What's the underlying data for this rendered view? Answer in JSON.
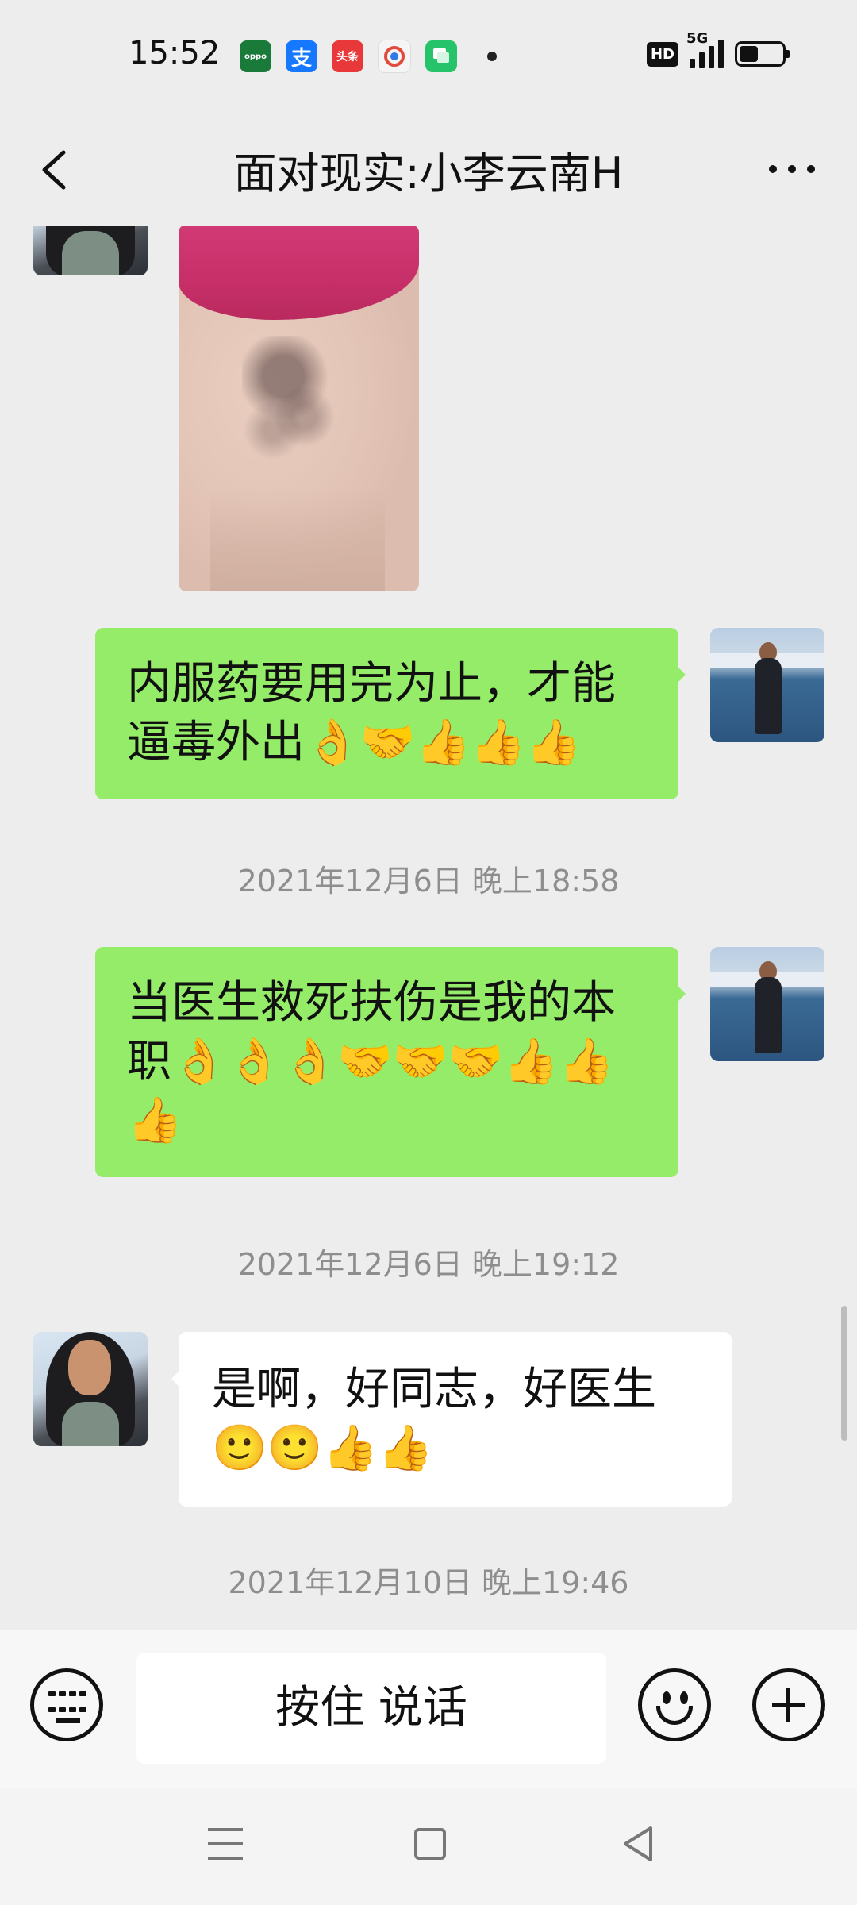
{
  "status_bar": {
    "time": "15:52",
    "apps": [
      {
        "name": "oppo-app-icon",
        "label": "oppo",
        "color": "#1a7a3a"
      },
      {
        "name": "alipay-icon",
        "label": "支",
        "color": "#1677ff"
      },
      {
        "name": "toutiao-icon",
        "label": "头条",
        "color": "#e8383a"
      },
      {
        "name": "browser-icon",
        "label": "",
        "color": "#f5f5f5"
      },
      {
        "name": "messages-icon",
        "label": "",
        "color": "#27c36a"
      }
    ],
    "hd_label": "HD",
    "network_label": "5G",
    "battery_level": 0.45
  },
  "header": {
    "title": "面对现实:小李云南H"
  },
  "messages": [
    {
      "type": "image",
      "side": "in"
    },
    {
      "type": "text",
      "side": "out",
      "text": "内服药要用完为止，才能逼毒外出👌🤝👍👍👍"
    },
    {
      "type": "timestamp",
      "text": "2021年12月6日 晚上18:58"
    },
    {
      "type": "text",
      "side": "out",
      "text": "当医生救死扶伤是我的本职👌👌👌🤝🤝🤝👍👍👍"
    },
    {
      "type": "timestamp",
      "text": "2021年12月6日 晚上19:12"
    },
    {
      "type": "text",
      "side": "in",
      "text": "是啊，好同志，好医生🙂🙂👍👍"
    },
    {
      "type": "timestamp",
      "text": "2021年12月10日 晚上19:46"
    }
  ],
  "input_bar": {
    "hold_to_talk_label": "按住 说话"
  }
}
